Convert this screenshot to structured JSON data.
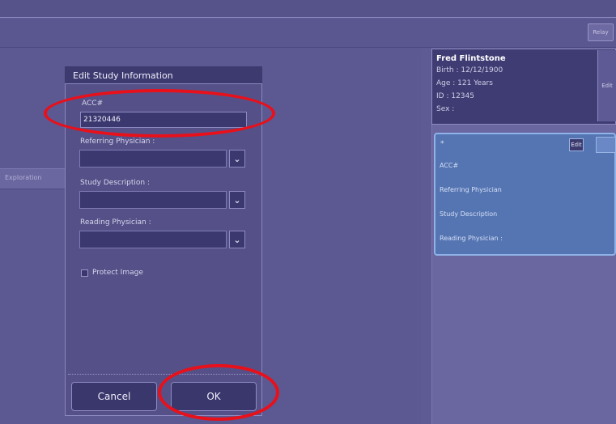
{
  "toolbar": {
    "button_label": "Relay"
  },
  "left_panel": {
    "row_text": "Exploration"
  },
  "dialog": {
    "title": "Edit Study Information",
    "acc_label": "ACC#",
    "acc_value": "21320446",
    "referring_label": "Referring Physician :",
    "referring_value": "",
    "study_desc_label": "Study Description :",
    "study_desc_value": "",
    "reading_label": "Reading Physician :",
    "reading_value": "",
    "protect_label": "Protect Image",
    "protect_checked": false,
    "cancel_label": "Cancel",
    "ok_label": "OK",
    "dropdown_icon": "chevron-down-icon"
  },
  "patient": {
    "name": "Fred Flintstone",
    "birth": "Birth : 12/12/1900",
    "age": "Age : 121 Years",
    "id": "ID : 12345",
    "sex": "Sex :",
    "side_tab": "Edit"
  },
  "study_card": {
    "star": "*",
    "edit_label": "Edit",
    "acc": "ACC#",
    "referring": "Referring Physician",
    "description": "Study Description",
    "reading": "Reading Physician :"
  },
  "annotation_color": "#e8101a"
}
